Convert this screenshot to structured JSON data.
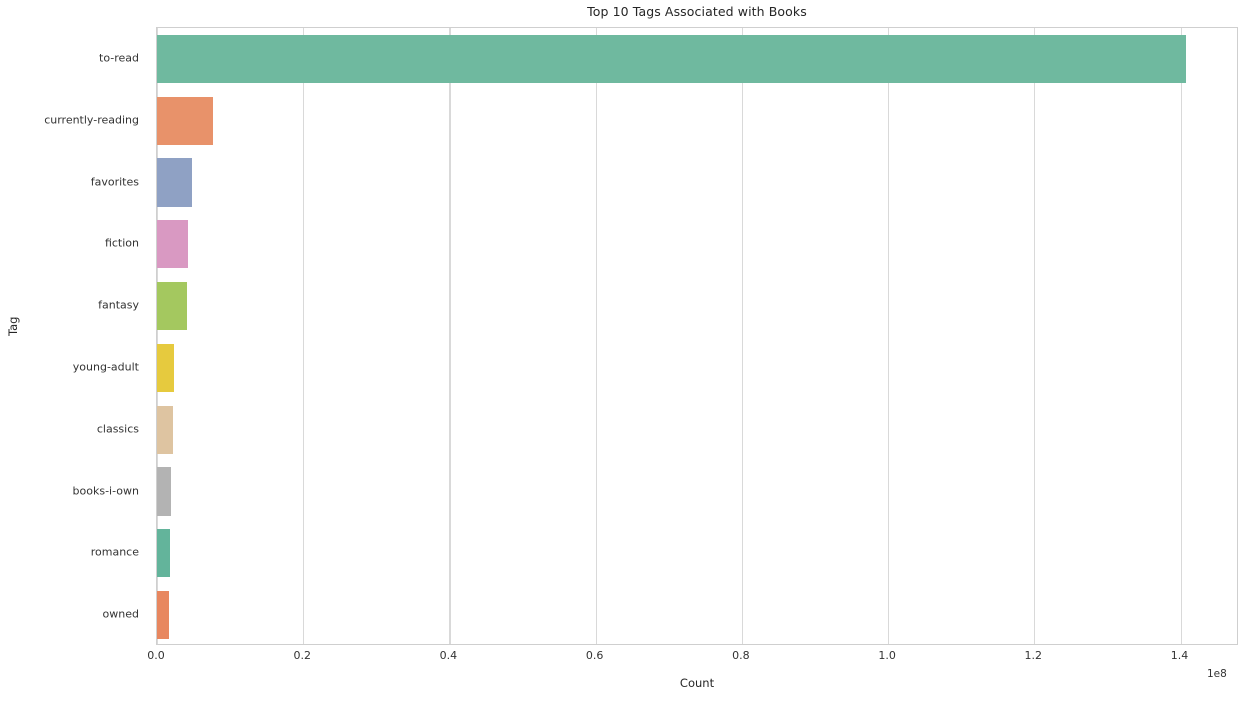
{
  "chart_data": {
    "type": "bar",
    "orientation": "horizontal",
    "title": "Top 10 Tags Associated with Books",
    "xlabel": "Count",
    "ylabel": "Tag",
    "categories": [
      "to-read",
      "currently-reading",
      "favorites",
      "fiction",
      "fantasy",
      "young-adult",
      "classics",
      "books-i-own",
      "romance",
      "owned"
    ],
    "values": [
      140700000,
      7650000,
      4800000,
      4300000,
      4150000,
      2300000,
      2150000,
      1850000,
      1750000,
      1600000
    ],
    "bar_colors": [
      "#6fb99f",
      "#e8926a",
      "#8fa1c4",
      "#d999c2",
      "#a4c85f",
      "#e6ca3e",
      "#dec4a1",
      "#b3b3b3",
      "#63b49b",
      "#e8875f"
    ],
    "xlim": [
      0,
      148000000.0
    ],
    "x_tick_values": [
      0,
      20000000,
      40000000,
      60000000,
      80000000,
      100000000,
      120000000,
      140000000
    ],
    "x_tick_labels": [
      "0.0",
      "0.2",
      "0.4",
      "0.6",
      "0.8",
      "1.0",
      "1.2",
      "1.4"
    ],
    "x_offset_text": "1e8",
    "grid": "vertical-only",
    "legend": "none",
    "background": "#ffffff",
    "grid_color": "#d9d9d9",
    "axes_edge_color": "#cfcfcf"
  }
}
